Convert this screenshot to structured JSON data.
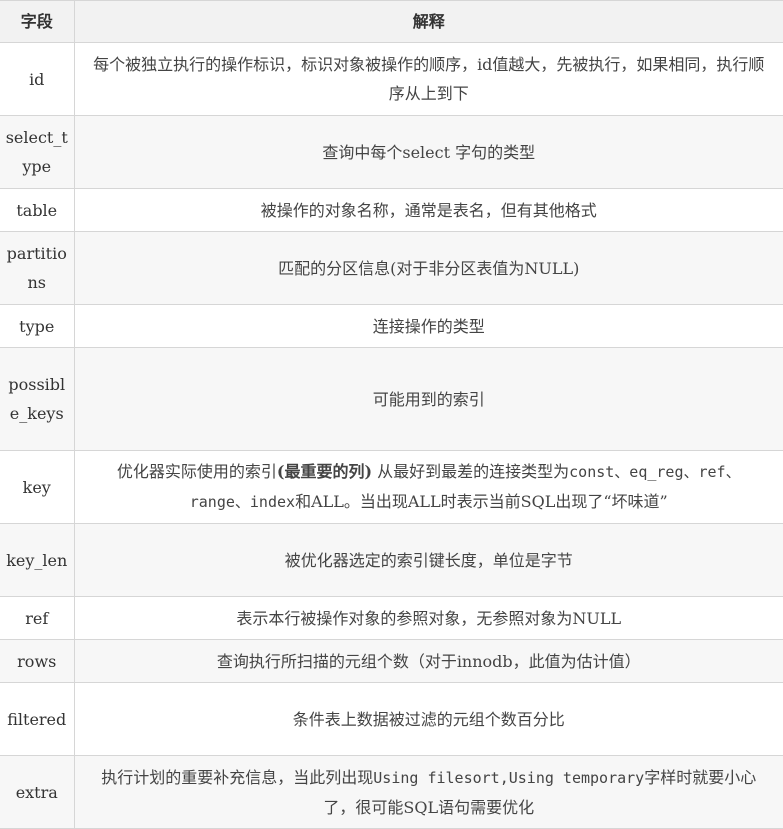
{
  "header": {
    "field": "字段",
    "desc": "解释"
  },
  "rows": [
    {
      "field": "id",
      "desc": "每个被独立执行的操作标识，标识对象被操作的顺序，id值越大，先被执行，如果相同，执行顺序从上到下"
    },
    {
      "field": "select_type",
      "desc": "查询中每个select 字句的类型"
    },
    {
      "field": "table",
      "desc": "被操作的对象名称，通常是表名，但有其他格式"
    },
    {
      "field": "partitions",
      "desc": "匹配的分区信息(对于非分区表值为NULL)"
    },
    {
      "field": "type",
      "desc": "连接操作的类型"
    },
    {
      "field": "possible_keys",
      "desc": "可能用到的索引"
    },
    {
      "field": "key",
      "desc_pre": "优化器实际使用的索引",
      "desc_bold": "(最重要的列)",
      "desc_mid": " 从最好到最差的连接类型为",
      "desc_code1": "const、eq_reg、ref、range、index",
      "desc_post": "和ALL。当出现ALL时表示当前SQL出现了“坏味道”"
    },
    {
      "field": "key_len",
      "desc": "被优化器选定的索引键长度，单位是字节"
    },
    {
      "field": "ref",
      "desc": "表示本行被操作对象的参照对象，无参照对象为NULL"
    },
    {
      "field": "rows",
      "desc": "查询执行所扫描的元组个数（对于innodb，此值为估计值）"
    },
    {
      "field": "filtered",
      "desc": "条件表上数据被过滤的元组个数百分比"
    },
    {
      "field": "extra",
      "desc_pre": "执行计划的重要补充信息，当此列出现",
      "desc_code1": "Using filesort,Using temporary",
      "desc_post": "字样时就要小心了，很可能SQL语句需要优化"
    }
  ]
}
